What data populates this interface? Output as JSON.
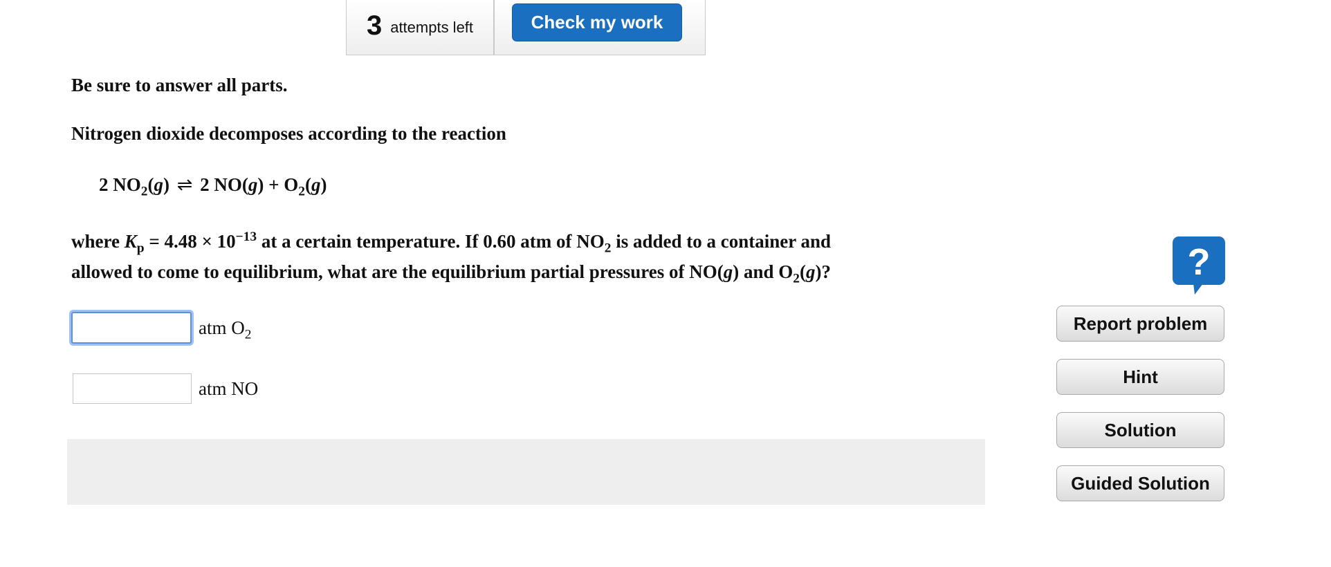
{
  "toolbar": {
    "attempts_count": "3",
    "attempts_label": "attempts left",
    "check_label": "Check my work"
  },
  "question": {
    "instruction": "Be sure to answer all parts.",
    "intro": "Nitrogen dioxide decomposes according to the reaction",
    "equation": {
      "reactant_coef": "2",
      "reactant": "NO",
      "reactant_sub": "2",
      "state_g": "g",
      "arrow": "⇌",
      "prod1_coef": "2",
      "prod1": "NO",
      "plus": "+",
      "prod2": "O",
      "prod2_sub": "2"
    },
    "body1_a": "where ",
    "kp_symbol": "K",
    "kp_sub": "p",
    "kp_value": " = 4.48 × 10",
    "kp_exp": "−13",
    "body1_b": " at a certain temperature. If 0.60 atm of NO",
    "no2_sub": "2",
    "body1_c": " is added to a container and",
    "body2_a": "allowed to come to equilibrium, what are the equilibrium partial pressures of NO(",
    "body2_g": "g",
    "body2_b": ") and O",
    "o2_sub": "2",
    "body2_c": "(",
    "body2_d": ")?"
  },
  "answers": [
    {
      "value": "",
      "unit_prefix": "atm O",
      "unit_sub": "2"
    },
    {
      "value": "",
      "unit_prefix": "atm NO",
      "unit_sub": ""
    }
  ],
  "sidebar": {
    "help_icon": "question-bubble-icon",
    "buttons": [
      "Report problem",
      "Hint",
      "Solution",
      "Guided Solution"
    ]
  },
  "colors": {
    "primary": "#1a6fc0",
    "focus": "#5b8fe0",
    "panel": "#eeeeee"
  }
}
